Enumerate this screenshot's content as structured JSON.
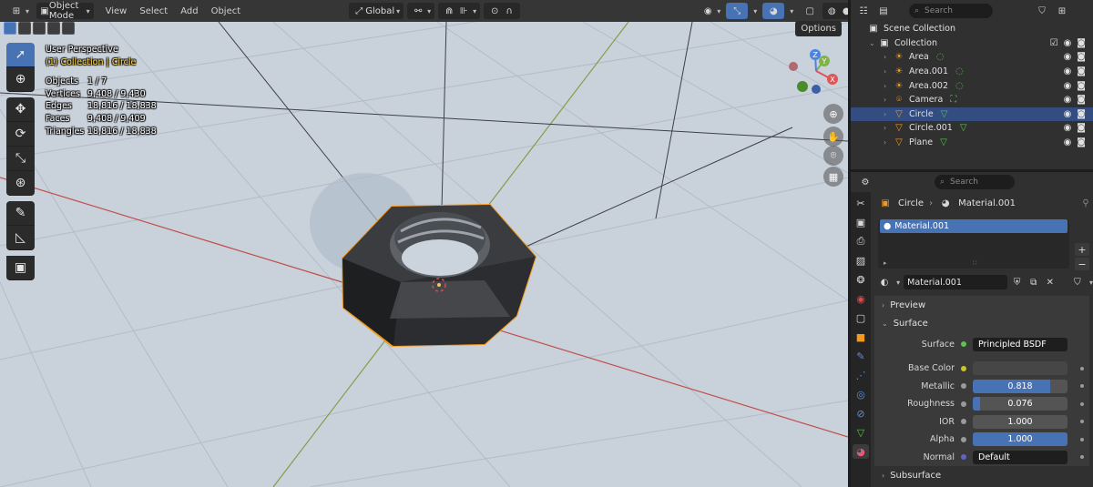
{
  "header": {
    "mode": "Object Mode",
    "menus": [
      "View",
      "Select",
      "Add",
      "Object"
    ],
    "orientation": "Global",
    "options": "Options"
  },
  "overlay": {
    "view_name": "User Perspective",
    "collection": "(1) Collection | Circle",
    "stats": [
      {
        "label": "Objects",
        "value": "1 / 7"
      },
      {
        "label": "Vertices",
        "value": "9,408 / 9,430"
      },
      {
        "label": "Edges",
        "value": "18,816 / 18,838"
      },
      {
        "label": "Faces",
        "value": "9,408 / 9,409"
      },
      {
        "label": "Triangles",
        "value": "18,816 / 18,838"
      }
    ]
  },
  "gizmo": {
    "x": "X",
    "y": "Y",
    "z": "Z"
  },
  "outliner": {
    "search_placeholder": "Search",
    "scene_collection": "Scene Collection",
    "collection": "Collection",
    "items": [
      {
        "name": "Area",
        "icon": "light-icon",
        "selected": false
      },
      {
        "name": "Area.001",
        "icon": "light-icon",
        "selected": false
      },
      {
        "name": "Area.002",
        "icon": "light-icon",
        "selected": false
      },
      {
        "name": "Camera",
        "icon": "camera-icon",
        "selected": false
      },
      {
        "name": "Circle",
        "icon": "mesh-icon",
        "selected": true
      },
      {
        "name": "Circle.001",
        "icon": "mesh-icon",
        "selected": false
      },
      {
        "name": "Plane",
        "icon": "mesh-icon",
        "selected": false
      }
    ]
  },
  "properties": {
    "search_placeholder": "Search",
    "breadcrumb_object": "Circle",
    "breadcrumb_material": "Material.001",
    "slot_name": "Material.001",
    "material_name": "Material.001",
    "preview_label": "Preview",
    "surface_label": "Surface",
    "surface_shader_label": "Surface",
    "surface_shader_value": "Principled BSDF",
    "fields": [
      {
        "label": "Base Color",
        "value": "",
        "fill": 0,
        "dot": "#c7c729",
        "type": "color"
      },
      {
        "label": "Metallic",
        "value": "0.818",
        "fill": 0.818,
        "dot": "#9a9a9a",
        "type": "slider"
      },
      {
        "label": "Roughness",
        "value": "0.076",
        "fill": 0.076,
        "dot": "#9a9a9a",
        "type": "slider"
      },
      {
        "label": "IOR",
        "value": "1.000",
        "fill": 0,
        "dot": "#9a9a9a",
        "type": "slider"
      },
      {
        "label": "Alpha",
        "value": "1.000",
        "fill": 1.0,
        "dot": "#9a9a9a",
        "type": "slider"
      },
      {
        "label": "Normal",
        "value": "Default",
        "fill": 0,
        "dot": "#6363c7",
        "type": "text"
      }
    ],
    "subsurface_label": "Subsurface"
  },
  "colors": {
    "accent": "#4772b3",
    "selection_outline": "#f39a1d",
    "grid_x_axis": "#c0504d",
    "grid_y_axis": "#7fa04a"
  }
}
